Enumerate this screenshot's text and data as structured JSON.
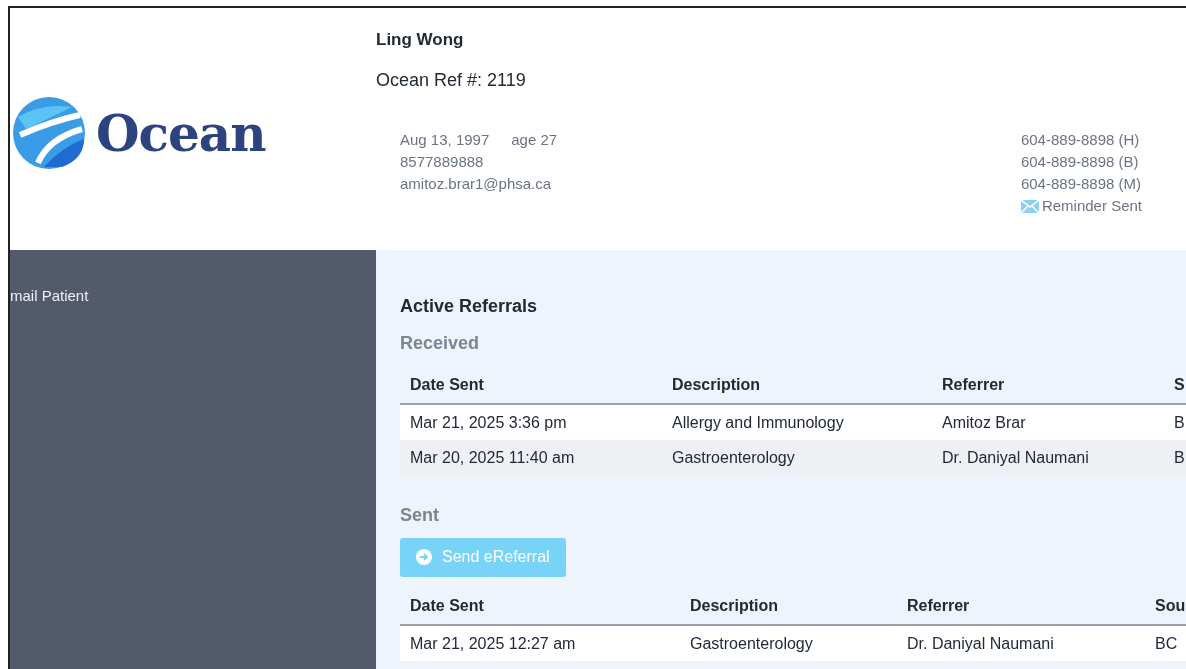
{
  "logo": {
    "text": "Ocean"
  },
  "patient": {
    "name": "Ling Wong",
    "ref": "Ocean Ref #: 2119",
    "dob": "Aug 13, 1997",
    "age": "age 27",
    "health_number": "8577889888",
    "email": "amitoz.brar1@phsa.ca",
    "phones": [
      "604-889-8898 (H)",
      "604-889-8898 (B)",
      "604-889-8898 (M)"
    ],
    "reminder": "Reminder Sent"
  },
  "sidebar": {
    "items": [
      {
        "label": "mail Patient"
      }
    ]
  },
  "active_referrals": {
    "title": "Active Referrals",
    "received": {
      "title": "Received",
      "columns": [
        "Date Sent",
        "Description",
        "Referrer",
        "S"
      ],
      "rows": [
        [
          "Mar 21, 2025 3:36 pm",
          "Allergy and Immunology",
          "Amitoz Brar",
          "B"
        ],
        [
          "Mar 20, 2025 11:40 am",
          "Gastroenterology",
          "Dr. Daniyal Naumani",
          "B"
        ]
      ]
    },
    "sent": {
      "title": "Sent",
      "button": "Send eReferral",
      "columns": [
        "Date Sent",
        "Description",
        "Referrer",
        "Sou"
      ],
      "rows": [
        [
          "Mar 21, 2025 12:27 am",
          "Gastroenterology",
          "Dr. Daniyal Naumani",
          "BC"
        ]
      ]
    }
  }
}
